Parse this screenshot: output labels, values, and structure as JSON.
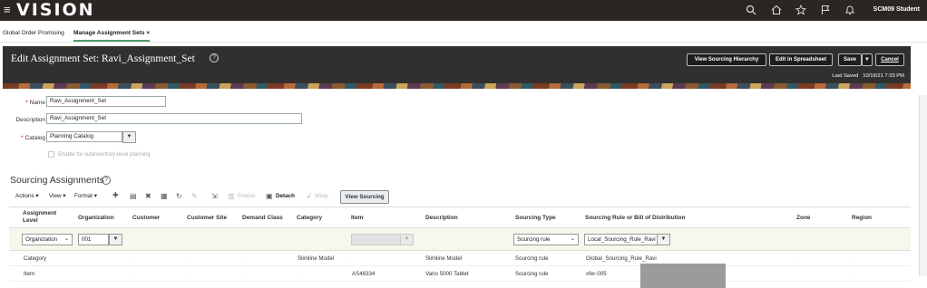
{
  "top": {
    "logo": "VISION",
    "user": "SCM09 Student",
    "hamburger": "≡"
  },
  "tabs": [
    {
      "label": "Global Order Promising"
    },
    {
      "label": "Manage Assignment Sets",
      "close": "×"
    }
  ],
  "header": {
    "title": "Edit Assignment Set: Ravi_Assignment_Set",
    "help": "?",
    "buttons": {
      "view_hierarchy": "View Sourcing Hierarchy",
      "edit_spreadsheet": "Edit in Spreadsheet",
      "save": "Save",
      "save_menu": "▼",
      "cancel": "Cancel"
    },
    "last_saved_label": "Last Saved",
    "last_saved_value": "10/16/21 7:33 PM"
  },
  "form": {
    "name_label": "Name",
    "name_value": "Ravi_Assignment_Set",
    "description_label": "Description",
    "description_value": "Ravi_Assignment_Set",
    "catalog_label": "Catalog",
    "catalog_value": "Planning Catalog",
    "subinv_label": "Enable for subinventory-level planning",
    "required_mark": "*"
  },
  "section": {
    "title": "Sourcing Assignments",
    "help": "?"
  },
  "toolbar": {
    "actions": "Actions ▾",
    "view": "View ▾",
    "format": "Format ▾",
    "freeze": "Freeze",
    "detach": "Detach",
    "wrap": "Wrap",
    "view_sourcing": "View Sourcing"
  },
  "table": {
    "headers": {
      "level": "Assignment Level",
      "org": "Organization",
      "customer": "Customer",
      "site": "Customer Site",
      "demand": "Demand Class",
      "category": "Category",
      "item": "Item",
      "description": "Description",
      "stype": "Sourcing Type",
      "rule": "Sourcing Rule or Bill of Distribution",
      "zone": "Zone",
      "region": "Region"
    },
    "edit_row": {
      "level": "Organization",
      "org": "001",
      "stype": "Sourcing rule",
      "rule": "Local_Sourcing_Rule_Ravi",
      "dd": "▼",
      "chev": "⌄"
    },
    "rows": [
      {
        "level": "Category",
        "category": "Slimline Model",
        "item": "",
        "description": "Slimline Model",
        "stype": "Sourcing rule",
        "rule": "Global_Sourcing_Rule_Ravi"
      },
      {
        "level": "Item",
        "category": "",
        "item": "AS46334",
        "description": "Vario 5000 Tablet",
        "stype": "Sourcing rule",
        "rule": "xfer-005"
      }
    ],
    "dot": "."
  }
}
